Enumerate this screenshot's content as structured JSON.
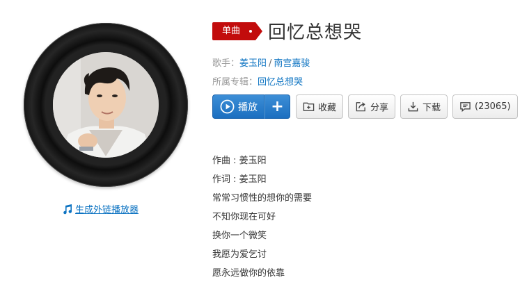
{
  "song": {
    "tag": "单曲",
    "title": "回忆总想哭"
  },
  "meta": {
    "singer_label": "歌手：",
    "singers": [
      "姜玉阳",
      "南宫嘉骏"
    ],
    "singer_separator": "/",
    "album_label": "所属专辑：",
    "album": "回忆总想哭"
  },
  "actions": {
    "play": "播放",
    "add": "+",
    "collect": "收藏",
    "share": "分享",
    "download": "下载",
    "comment": "(23065)"
  },
  "sidebar": {
    "ext_link": "生成外链播放器"
  },
  "lyrics": [
    "作曲 : 姜玉阳",
    "作词 : 姜玉阳",
    "常常习惯性的想你的需要",
    "不知你现在可好",
    "换你一个微笑",
    "我愿为爱乞讨",
    "愿永远做你的依靠"
  ],
  "colors": {
    "accent_red": "#c20c0c",
    "link_blue": "#0c73c2",
    "play_blue": "#2477c9"
  }
}
